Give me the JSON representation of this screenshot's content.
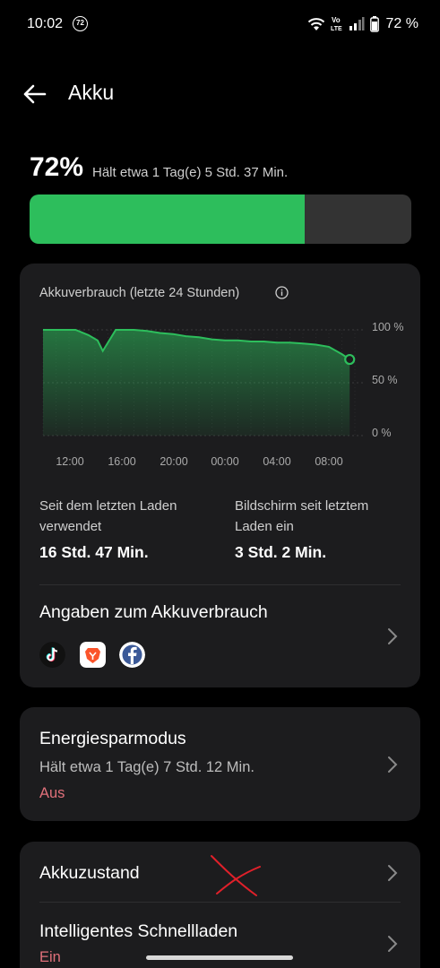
{
  "status_bar": {
    "time": "10:02",
    "notification_badge": "72",
    "network_label_top": "Vo",
    "network_label_bottom": "LTE",
    "battery_percent_text": "72 %",
    "icons": [
      "wifi-icon",
      "volte-icon",
      "signal-icon",
      "battery-icon"
    ]
  },
  "header": {
    "title": "Akku",
    "back_icon": "arrow-left-icon"
  },
  "battery": {
    "percent_label": "72%",
    "level": 0.72,
    "remaining_text": "Hält etwa 1 Tag(e) 5 Std. 37 Min.",
    "fill_color": "#2dbe5c"
  },
  "usage_card": {
    "chart_title": "Akkuverbrauch (letzte 24 Stunden)",
    "y_ticks": [
      "100 %",
      "50 %",
      "0 %"
    ],
    "x_ticks": [
      "12:00",
      "16:00",
      "20:00",
      "00:00",
      "04:00",
      "08:00"
    ],
    "since_charge_label": "Seit dem letzten Laden verwendet",
    "since_charge_value": "16 Std. 47 Min.",
    "screen_on_label": "Bildschirm seit letztem Laden ein",
    "screen_on_value": "3 Std. 2 Min.",
    "details_title": "Angaben zum Akkuverbrauch",
    "apps": [
      "tiktok-icon",
      "brave-icon",
      "facebook-icon"
    ]
  },
  "chart_data": {
    "type": "area",
    "title": "Akkuverbrauch (letzte 24 Stunden)",
    "x_unit": "hours since 10:00",
    "x": [
      0,
      1.5,
      2.5,
      3.5,
      4.2,
      4.6,
      5.6,
      7,
      8,
      9,
      10,
      11,
      12,
      13,
      14,
      15,
      16,
      17,
      18,
      19,
      20,
      21,
      22,
      23,
      23.6
    ],
    "y": [
      100,
      100,
      100,
      95,
      90,
      80,
      100,
      100,
      99,
      97,
      96,
      94,
      93,
      91,
      90,
      90,
      89,
      89,
      88,
      88,
      87,
      86,
      84,
      77,
      72
    ],
    "ylim": [
      0,
      100
    ],
    "xlim": [
      0,
      24
    ],
    "line_color": "#2dbe5c"
  },
  "saver_card": {
    "title": "Energiesparmodus",
    "subtitle": "Hält etwa 1 Tag(e) 7 Std. 12 Min.",
    "status": "Aus"
  },
  "health_card": {
    "item1_title": "Akkuzustand",
    "item2_title": "Intelligentes Schnellladen",
    "item2_status": "Ein"
  }
}
